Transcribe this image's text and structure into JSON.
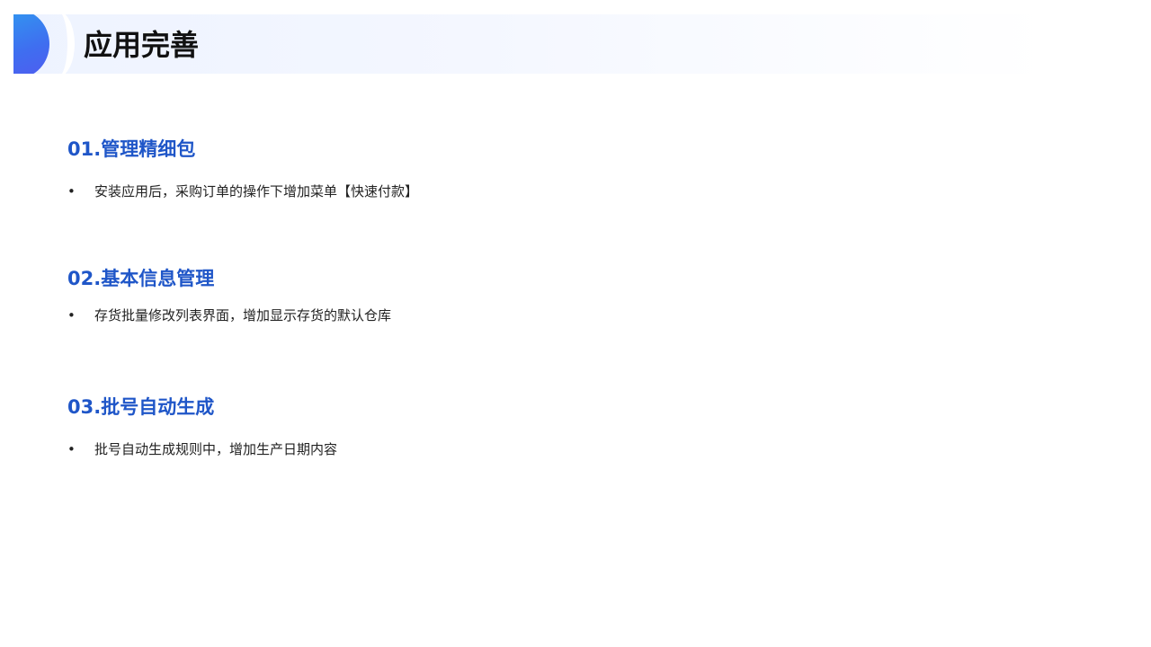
{
  "page": {
    "title": "应用完善"
  },
  "colors": {
    "accent": "#1f56c8",
    "header_gradient_start": "#2f9df0",
    "header_gradient_end": "#4f5cf0"
  },
  "sections": [
    {
      "heading": "01.管理精细包",
      "bullet_symbol": "•",
      "bullet": "安装应用后，采购订单的操作下增加菜单【快速付款】"
    },
    {
      "heading": "02.基本信息管理",
      "bullet_symbol": "•",
      "bullet": "存货批量修改列表界面，增加显示存货的默认仓库"
    },
    {
      "heading": "03.批号自动生成",
      "bullet_symbol": "•",
      "bullet": "批号自动生成规则中，增加生产日期内容"
    }
  ]
}
